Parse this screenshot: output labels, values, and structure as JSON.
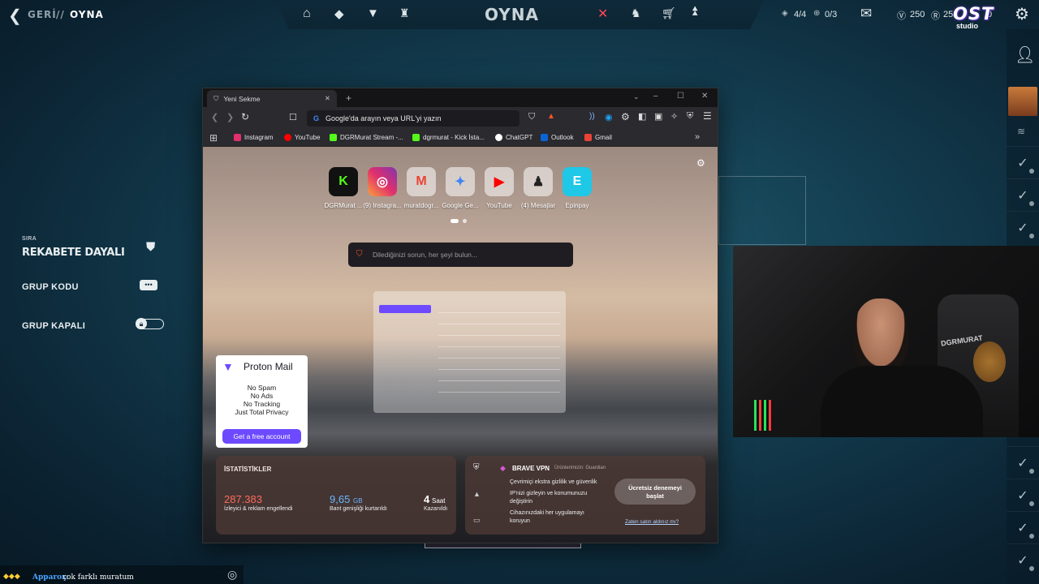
{
  "topbar": {
    "back_label": "GERİ",
    "separator": "//",
    "section_label": "OYNA",
    "center_title": "OYNA",
    "party_count": "4/4",
    "queue_count": "0/3",
    "valorant_points": "250",
    "radianite_points": "25",
    "points_suffix": "0",
    "icons": [
      "home-icon",
      "career-icon",
      "battlepass-icon",
      "collection-icon",
      "agents-icon",
      "agent-icon",
      "store-icon",
      "rank-icon",
      "mail-icon",
      "settings-icon"
    ]
  },
  "overlay_logo": {
    "title": "OST",
    "subtitle": "studio"
  },
  "lobby": {
    "queue_caption": "SIRA",
    "queue_value": "REKABETE DAYALI",
    "group_code_label": "GRUP KODU",
    "group_closed_label": "GRUP KAPALI"
  },
  "browser": {
    "tab_title": "Yeni Sekme",
    "url_placeholder": "Google'da arayın veya URL'yi yazın",
    "bookmarks": [
      {
        "label": "Instagram",
        "color": "#e1306c"
      },
      {
        "label": "YouTube",
        "color": "#ff0000"
      },
      {
        "label": "DGRMurat Stream -...",
        "color": "#53fc18"
      },
      {
        "label": "dgrmurat - Kick İsta...",
        "color": "#53fc18"
      },
      {
        "label": "ChatGPT",
        "color": "#ffffff"
      },
      {
        "label": "Outlook",
        "color": "#0a64d8"
      },
      {
        "label": "Gmail",
        "color": "#ea4335"
      }
    ],
    "top_sites": [
      {
        "label": "DGRMurat ...",
        "glyph": "K",
        "color": "#53fc18"
      },
      {
        "label": "(9) Instagra...",
        "glyph": "◎",
        "color": "#e1306c"
      },
      {
        "label": "muratdogr...",
        "glyph": "M",
        "color": "#ea4335"
      },
      {
        "label": "Google Ge...",
        "glyph": "✦",
        "color": "#4285f4"
      },
      {
        "label": "YouTube",
        "glyph": "▶",
        "color": "#ff0000"
      },
      {
        "label": "(4) Mesajlar",
        "glyph": "♟",
        "color": "#222222"
      },
      {
        "label": "Epinpay",
        "glyph": "E",
        "color": "#1ec8e6"
      }
    ],
    "search_placeholder": "Dilediğinizi sorun, her şeyi bulun...",
    "proton_ad": {
      "brand": "Proton Mail",
      "lines": [
        "No Spam",
        "No Ads",
        "No Tracking",
        "Just Total Privacy"
      ],
      "cta": "Get a free account"
    },
    "stats": {
      "title": "İSTATİSTİKLER",
      "blocked_value": "287.383",
      "blocked_label": "İzleyici & reklam engellendi",
      "bandwidth_value": "9,65",
      "bandwidth_unit": "GB",
      "bandwidth_label": "Bant genişliği kurtarıldı",
      "time_value": "4",
      "time_unit": "Saat",
      "time_label": "Kazanıldı"
    },
    "vpn": {
      "title": "BRAVE VPN",
      "powered": "Ürünlerimizin: Guardian",
      "features": [
        "Çevrimiçi ekstra gizlilik ve güvenlik",
        "IP'nizi gizleyin ve konumunuzu değiştirin",
        "Cihazınızdaki her uygulamayı koruyun"
      ],
      "cta": "Ücretsiz denemeyi başlat",
      "link": "Zaten satın aldınız mı?"
    }
  },
  "chat": {
    "author": "Apparox:",
    "message": "çok farklı muratum"
  },
  "webcam": {
    "shirt_text": "DGRMURAT"
  },
  "colors": {
    "accent_red": "#ff4655",
    "brave_orange": "#fb542b",
    "stats_red": "#ff6b5b",
    "stats_blue": "#6ab7ff",
    "proton_purple": "#6d4aff"
  }
}
